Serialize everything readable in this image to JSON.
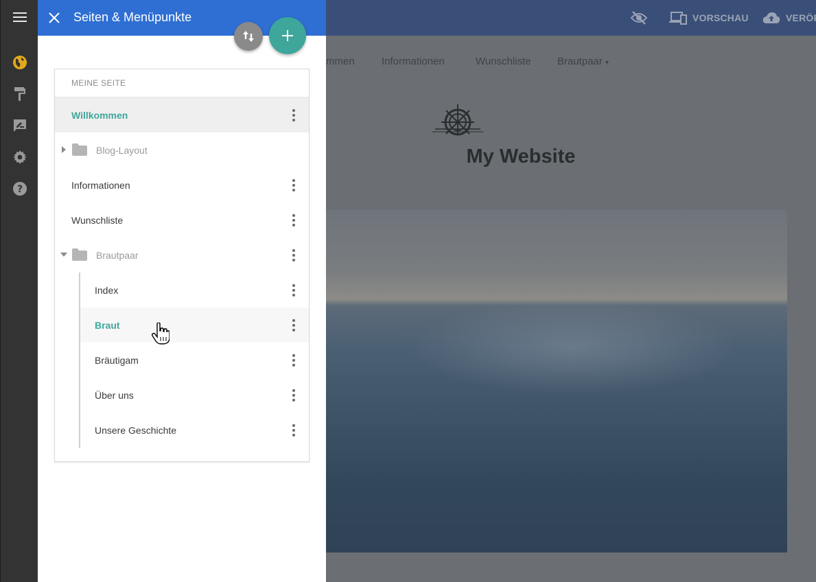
{
  "panel": {
    "title": "Seiten & Menüpunkte",
    "section_header": "MEINE SEITE",
    "rows": [
      {
        "label": "Willkommen"
      },
      {
        "label": "Blog-Layout"
      },
      {
        "label": "Informationen"
      },
      {
        "label": "Wunschliste"
      },
      {
        "label": "Brautpaar"
      },
      {
        "label": "Index"
      },
      {
        "label": "Braut"
      },
      {
        "label": "Bräutigam"
      },
      {
        "label": "Über uns"
      },
      {
        "label": "Unsere Geschichte"
      }
    ]
  },
  "topbar": {
    "preview_label": "VORSCHAU",
    "publish_label": "VERÖF"
  },
  "site": {
    "nav": [
      "mmen",
      "Informationen",
      "Wunschliste",
      "Brautpaar"
    ],
    "title": "My Website"
  },
  "colors": {
    "accent_teal": "#3ea69a",
    "header_blue": "#2f6fd3",
    "rail_active_yellow": "#e2a81c"
  }
}
